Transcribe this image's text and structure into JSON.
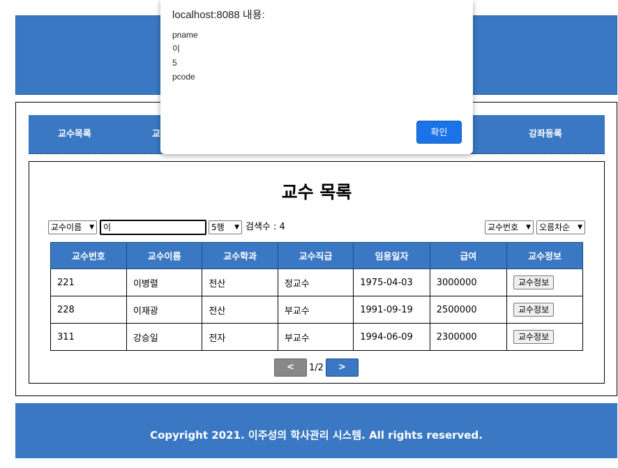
{
  "nav": {
    "items": [
      "교수목록",
      "교",
      "강좌등록"
    ]
  },
  "content": {
    "title": "교수 목록",
    "search_field_select": "교수이름",
    "search_input_value": "이",
    "rows_select": "5행",
    "result_count": "검색수 : 4",
    "sort_field_select": "교수번호",
    "sort_order_select": "오름차순"
  },
  "table": {
    "headers": [
      "교수번호",
      "교수이름",
      "교수학과",
      "교수직급",
      "임용일자",
      "급여",
      "교수정보"
    ],
    "rows": [
      [
        "221",
        "이병렬",
        "전산",
        "정교수",
        "1975-04-03",
        "3000000",
        "교수정보"
      ],
      [
        "228",
        "이재광",
        "전산",
        "부교수",
        "1991-09-19",
        "2500000",
        "교수정보"
      ],
      [
        "311",
        "강승일",
        "전자",
        "부교수",
        "1994-06-09",
        "2300000",
        "교수정보"
      ]
    ]
  },
  "pager": {
    "prev_label": "<",
    "page_text": "1/2",
    "next_label": ">"
  },
  "footer": {
    "copyright": "Copyright 2021. 이주성의 학사관리 시스템. All rights reserved."
  },
  "dialog": {
    "title": "localhost:8088 내용:",
    "lines": [
      "pname",
      "이",
      "5",
      "pcode"
    ],
    "ok_label": "확인"
  },
  "colors": {
    "brand_blue": "#3a78c4",
    "dialog_button": "#1a73e8"
  }
}
